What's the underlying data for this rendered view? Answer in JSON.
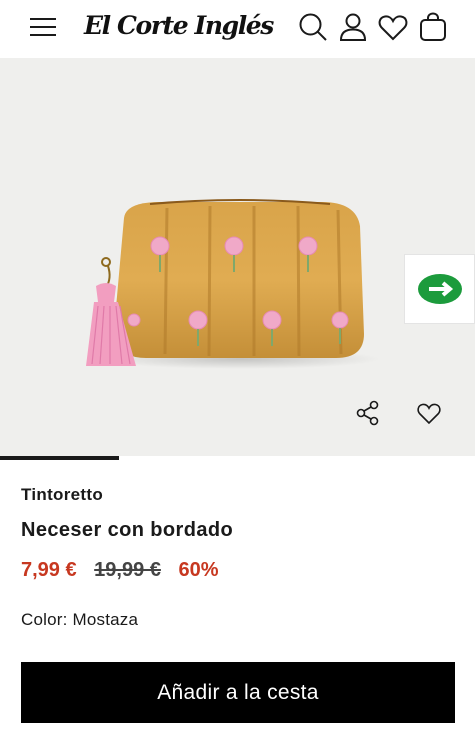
{
  "header": {
    "logo_text": "El Corte Inglés",
    "icons": [
      "menu-icon",
      "search-icon",
      "user-icon",
      "heart-icon",
      "shopping-bag-icon"
    ]
  },
  "gallery": {
    "icons": [
      "whatsapp-icon",
      "share-icon",
      "heart-icon"
    ],
    "progress": 0.25
  },
  "product": {
    "brand": "Tintoretto",
    "title": "Neceser con bordado",
    "price_current": "7,99 €",
    "price_old": "19,99 €",
    "discount": "60%",
    "color_label": "Color:",
    "color_value": "Mostaza"
  },
  "cta": {
    "label": "Añadir a la cesta"
  },
  "colors": {
    "sale_red": "#c73820",
    "cta_black": "#000000",
    "gallery_bg": "#efefed",
    "whatsapp_green": "#1c9b3c"
  }
}
